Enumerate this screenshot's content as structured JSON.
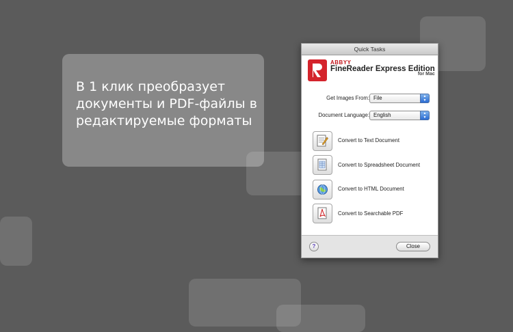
{
  "promo": {
    "line1": "В 1 клик преобразует",
    "line2": "документы и PDF-файлы в",
    "line3": "редактируемые форматы"
  },
  "window": {
    "title": "Quick Tasks",
    "logo": {
      "brand": "ABBYY",
      "product": "FineReader Express Edition",
      "platform": "for Mac"
    },
    "get_images": {
      "label": "Get Images From:",
      "value": "File"
    },
    "document_language": {
      "label": "Document Language:",
      "value": "English"
    },
    "tasks": [
      {
        "label": "Convert to Text Document",
        "icon": "text-document-icon"
      },
      {
        "label": "Convert to Spreadsheet Document",
        "icon": "spreadsheet-icon"
      },
      {
        "label": "Convert to HTML Document",
        "icon": "html-globe-icon"
      },
      {
        "label": "Convert to Searchable PDF",
        "icon": "pdf-icon"
      }
    ],
    "help_label": "?",
    "close_label": "Close"
  }
}
